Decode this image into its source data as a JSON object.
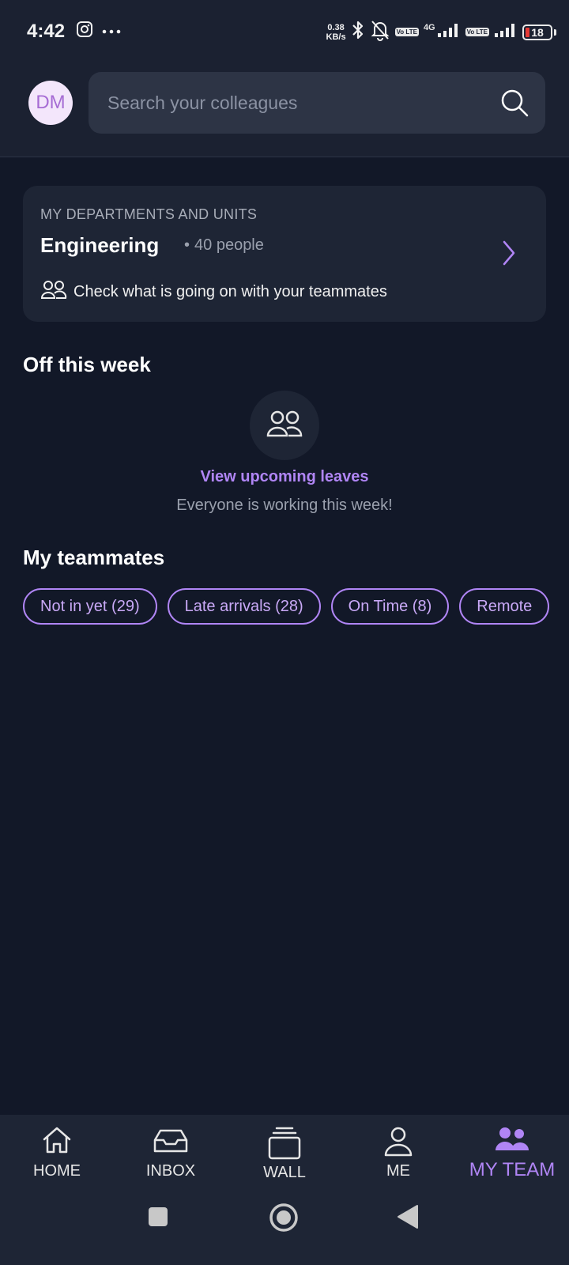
{
  "status_bar": {
    "time": "4:42",
    "net_speed_value": "0.38",
    "net_speed_unit": "KB/s",
    "volte1": "Vo LTE",
    "network": "4G",
    "volte2": "Vo LTE",
    "battery": "18",
    "icons": [
      "instagram-icon",
      "more-dots-icon",
      "bluetooth-icon",
      "bell-off-icon",
      "signal-icon",
      "battery-icon"
    ]
  },
  "header": {
    "avatar_initials": "DM",
    "search_placeholder": "Search your colleagues"
  },
  "departments": {
    "kicker": "MY DEPARTMENTS AND UNITS",
    "name": "Engineering",
    "count": "40 people",
    "subtitle": "Check what is going on with your teammates"
  },
  "off_this_week": {
    "title": "Off this week",
    "link": "View upcoming leaves",
    "note": "Everyone is working this week!"
  },
  "teammates": {
    "title": "My teammates",
    "filters": [
      "Not in yet (29)",
      "Late arrivals (28)",
      "On Time (8)",
      "Remote"
    ]
  },
  "bottom_nav": {
    "items": [
      {
        "label": "HOME",
        "icon": "home-icon"
      },
      {
        "label": "INBOX",
        "icon": "inbox-icon"
      },
      {
        "label": "WALL",
        "icon": "wall-icon"
      },
      {
        "label": "ME",
        "icon": "person-icon"
      },
      {
        "label": "MY TEAM",
        "icon": "team-icon",
        "active": true
      }
    ]
  },
  "colors": {
    "background": "#121828",
    "surface": "#1e2535",
    "accent": "#b085f5",
    "avatar_bg": "#f3e6fb"
  }
}
